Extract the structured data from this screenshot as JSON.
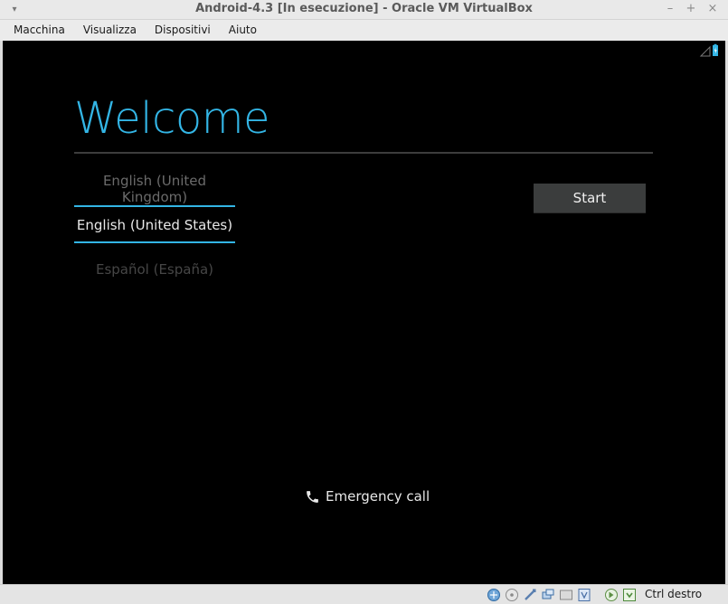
{
  "window": {
    "title": "Android-4.3 [In esecuzione] - Oracle VM VirtualBox",
    "controls": [
      "minimize-icon",
      "maximize-icon",
      "close-icon"
    ]
  },
  "menubar": {
    "items": [
      "Macchina",
      "Visualizza",
      "Dispositivi",
      "Aiuto"
    ]
  },
  "android": {
    "welcome": "Welcome",
    "languages": [
      {
        "label": "English (United Kingdom)",
        "state": "dim"
      },
      {
        "label": "English (United States)",
        "state": "selected"
      },
      {
        "label": "Español (España)",
        "state": "dimmer"
      }
    ],
    "start_label": "Start",
    "emergency_label": "Emergency call",
    "accent_color": "#33b5e5"
  },
  "statusbar": {
    "icons": [
      "network-icon",
      "optical-drive-icon",
      "usb-icon",
      "shared-folders-icon",
      "display-icon",
      "video-capture-icon",
      "mouse-integration-icon",
      "host-key-icon"
    ],
    "host_key": "Ctrl destro"
  }
}
